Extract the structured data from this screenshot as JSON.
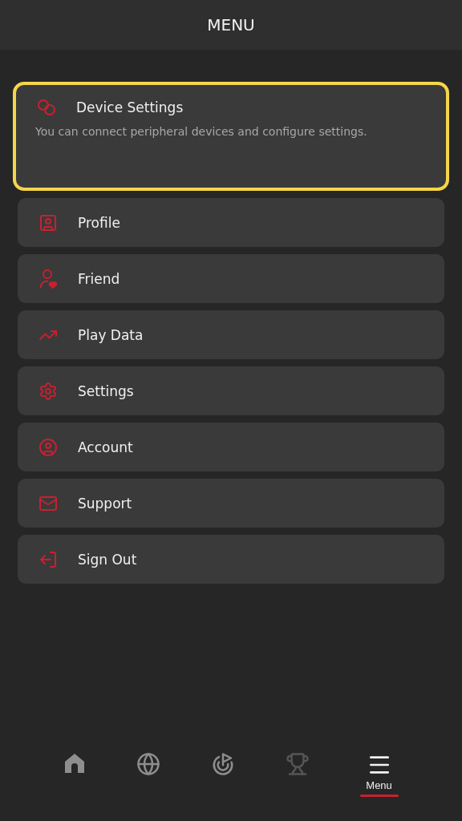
{
  "header": {
    "title": "MENU"
  },
  "menu": [
    {
      "kind": "device",
      "label": "Device Settings",
      "description": "You can connect peripheral devices and configure settings.",
      "selected": true
    },
    {
      "kind": "profile",
      "label": "Profile",
      "selected": false
    },
    {
      "kind": "friend",
      "label": "Friend",
      "selected": false
    },
    {
      "kind": "playdata",
      "label": "Play Data",
      "selected": false
    },
    {
      "kind": "settings",
      "label": "Settings",
      "selected": false
    },
    {
      "kind": "account",
      "label": "Account",
      "selected": false
    },
    {
      "kind": "support",
      "label": "Support",
      "selected": false
    },
    {
      "kind": "signout",
      "label": "Sign Out",
      "selected": false
    }
  ],
  "bottom_nav": [
    {
      "kind": "home",
      "selected": false,
      "disabled": false
    },
    {
      "kind": "globe",
      "selected": false,
      "disabled": false
    },
    {
      "kind": "target",
      "selected": false,
      "disabled": false
    },
    {
      "kind": "trophy",
      "selected": false,
      "disabled": true
    },
    {
      "kind": "menu",
      "label": "Menu",
      "selected": true,
      "disabled": false
    }
  ]
}
